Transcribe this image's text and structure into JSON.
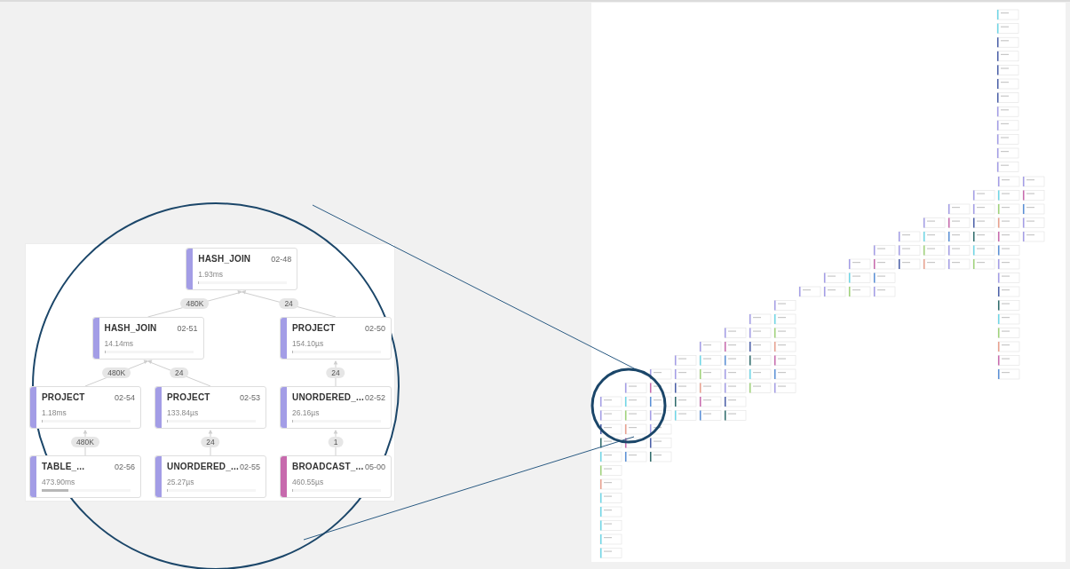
{
  "plan": {
    "root": {
      "name": "HASH_JOIN",
      "id": "02-48",
      "time": "1.93ms",
      "color": "#a39de6",
      "level": 0.01,
      "children": [
        {
          "name": "HASH_JOIN",
          "id": "02-51",
          "time": "14.14ms",
          "color": "#a39de6",
          "level": 0.01,
          "rows": "480K",
          "children": [
            {
              "name": "PROJECT",
              "id": "02-54",
              "time": "1.18ms",
              "color": "#a39de6",
              "level": 0.01,
              "rows": "480K",
              "children": [
                {
                  "name": "TABLE_...",
                  "id": "02-56",
                  "time": "473.90ms",
                  "color": "#a39de6",
                  "level": 0.3,
                  "rows": "480K"
                }
              ]
            },
            {
              "name": "PROJECT",
              "id": "02-53",
              "time": "133.84µs",
              "color": "#a39de6",
              "level": 0.01,
              "rows": "24",
              "children": [
                {
                  "name": "UNORDERED_...",
                  "id": "02-55",
                  "time": "25.27µs",
                  "color": "#a39de6",
                  "level": 0.01,
                  "rows": "24"
                }
              ]
            }
          ]
        },
        {
          "name": "PROJECT",
          "id": "02-50",
          "time": "154.10µs",
          "color": "#a39de6",
          "level": 0.01,
          "rows": "24",
          "children": [
            {
              "name": "UNORDERED_...",
              "id": "02-52",
              "time": "26.16µs",
              "color": "#a39de6",
              "level": 0.01,
              "rows": "24",
              "children": [
                {
                  "name": "BROADCAST_...",
                  "id": "05-00",
                  "time": "460.55µs",
                  "color": "#c76aad",
                  "level": 0.01,
                  "rows": "1"
                }
              ]
            }
          ]
        }
      ]
    }
  }
}
